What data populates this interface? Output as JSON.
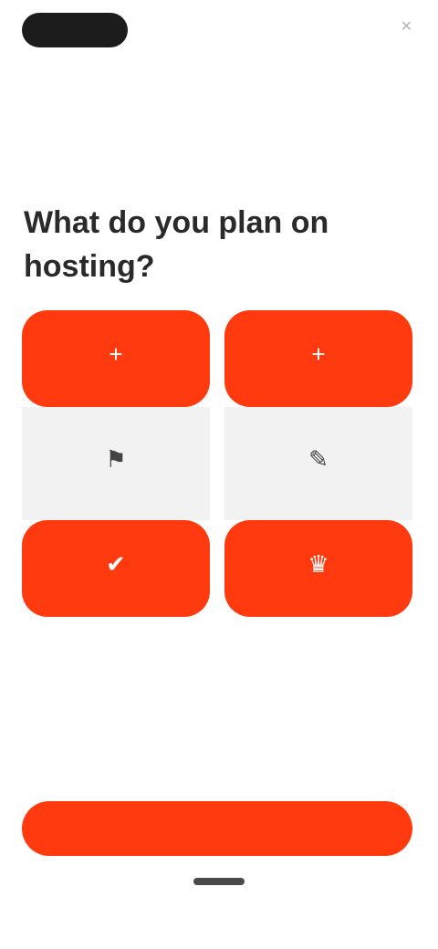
{
  "header": {
    "logo_text": "",
    "right_label": "",
    "right_icon": "close-icon"
  },
  "prompt": {
    "question": "What do you plan on hosting?"
  },
  "options": [
    {
      "icon": "plus-icon",
      "glyph": "+",
      "label": "",
      "style": "accent"
    },
    {
      "icon": "plus-icon",
      "glyph": "+",
      "label": "",
      "style": "accent"
    },
    {
      "icon": "flag-icon",
      "glyph": "⚑",
      "label": "",
      "style": "light"
    },
    {
      "icon": "pencil-icon",
      "glyph": "✎",
      "label": "",
      "style": "light"
    },
    {
      "icon": "check-icon",
      "glyph": "✔",
      "label": "",
      "style": "accent"
    },
    {
      "icon": "trophy-icon",
      "glyph": "♛",
      "label": "",
      "style": "accent"
    }
  ],
  "cta": {
    "label": ""
  },
  "colors": {
    "accent": "#ff3a0f",
    "light_tile": "#f2f2f2",
    "logo_bg": "#1c1c1c"
  }
}
